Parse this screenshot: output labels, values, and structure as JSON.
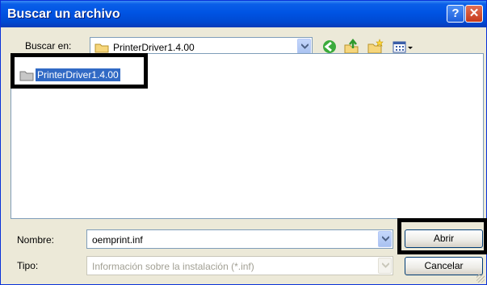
{
  "window": {
    "title": "Buscar un archivo",
    "help_glyph": "?",
    "close_glyph": "✕"
  },
  "look_in": {
    "label": "Buscar en:",
    "value": "PrinterDriver1.4.00"
  },
  "toolbar": {
    "icons": [
      "back-icon",
      "up-folder-icon",
      "new-folder-icon",
      "view-menu-icon"
    ]
  },
  "file_list": {
    "items": [
      {
        "name": "PrinterDriver1.4.00",
        "icon": "folder-icon"
      }
    ]
  },
  "filename": {
    "label": "Nombre:",
    "value": "oemprint.inf"
  },
  "filetype": {
    "label": "Tipo:",
    "value": "Información sobre la instalación (*.inf)"
  },
  "buttons": {
    "open": "Abrir",
    "cancel": "Cancelar"
  },
  "colors": {
    "titlebar": "#0054e3",
    "selection": "#316ac5",
    "dialog": "#ece9d8",
    "highlight_box": "#000000"
  }
}
